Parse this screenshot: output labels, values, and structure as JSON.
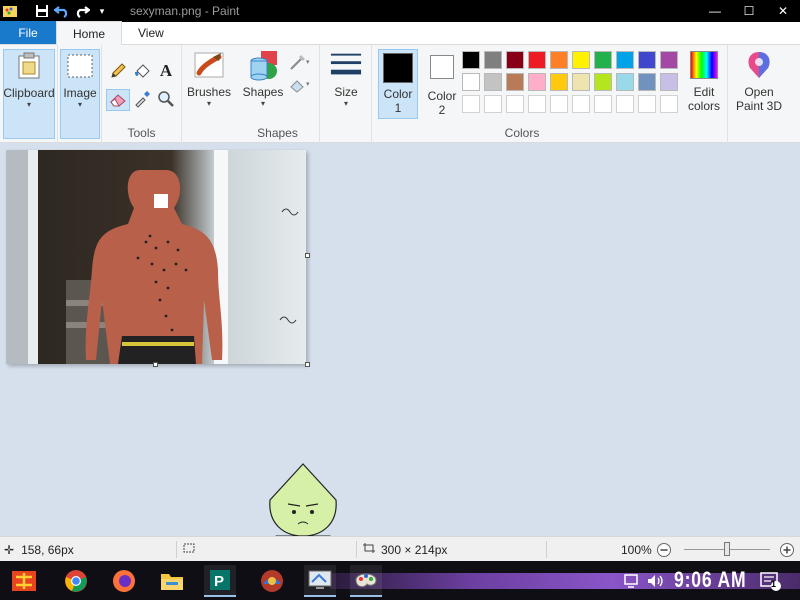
{
  "window": {
    "title": "sexyman.png - Paint",
    "minimize": "—",
    "maximize": "☐",
    "close": "✕"
  },
  "quick_access": {
    "save_icon": "save-icon",
    "undo_icon": "undo-icon",
    "redo_icon": "redo-icon",
    "customize_icon": "chevron-down-icon"
  },
  "tabs": [
    "File",
    "Home",
    "View"
  ],
  "ribbon": {
    "clipboard": {
      "label": "Clipboard"
    },
    "image": {
      "label": "Image"
    },
    "tools": {
      "group_label": "Tools"
    },
    "brushes": {
      "label": "Brushes"
    },
    "shapes": {
      "label": "Shapes",
      "group_label": "Shapes"
    },
    "size": {
      "label": "Size"
    },
    "color1": {
      "label_line1": "Color",
      "label_line2": "1",
      "value": "#000000"
    },
    "color2": {
      "label_line1": "Color",
      "label_line2": "2",
      "value": "#ffffff"
    },
    "colors": {
      "group_label": "Colors"
    },
    "edit_colors": {
      "label_line1": "Edit",
      "label_line2": "colors"
    },
    "paint3d": {
      "label_line1": "Open",
      "label_line2": "Paint 3D"
    }
  },
  "palette": {
    "row1": [
      "#000000",
      "#7f7f7f",
      "#880015",
      "#ed1c24",
      "#ff7f27",
      "#fff200",
      "#22b14c",
      "#00a2e8",
      "#3f48cc",
      "#a349a4"
    ],
    "row2": [
      "#ffffff",
      "#c3c3c3",
      "#b97a57",
      "#ffaec9",
      "#ffc90e",
      "#efe4b0",
      "#b5e61d",
      "#99d9ea",
      "#7092be",
      "#c8bfe7"
    ],
    "row3_empty_count": 10
  },
  "statusbar": {
    "cursor_position": "158, 66px",
    "image_size": "300 × 214px",
    "zoom": "100%",
    "zoom_level": 0.5
  },
  "taskbar": {
    "clock": "9:06 AM",
    "notification_count": "1"
  }
}
